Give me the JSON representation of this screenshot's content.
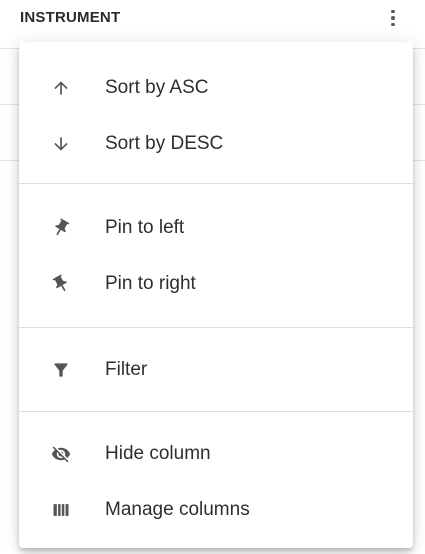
{
  "column": {
    "title": "INSTRUMENT",
    "menu_icon": "more-vert-icon"
  },
  "menu": {
    "groups": [
      {
        "items": [
          {
            "label": "Sort by ASC",
            "icon": "arrow-up-icon"
          },
          {
            "label": "Sort by DESC",
            "icon": "arrow-down-icon"
          }
        ]
      },
      {
        "items": [
          {
            "label": "Pin to left",
            "icon": "push-pin-left-icon"
          },
          {
            "label": "Pin to right",
            "icon": "push-pin-right-icon"
          }
        ]
      },
      {
        "items": [
          {
            "label": "Filter",
            "icon": "filter-icon"
          }
        ]
      },
      {
        "items": [
          {
            "label": "Hide column",
            "icon": "visibility-off-icon"
          },
          {
            "label": "Manage columns",
            "icon": "view-column-icon"
          }
        ]
      }
    ]
  },
  "colors": {
    "icon": "#555555",
    "text": "#2e2e2e",
    "divider": "#dedede"
  }
}
